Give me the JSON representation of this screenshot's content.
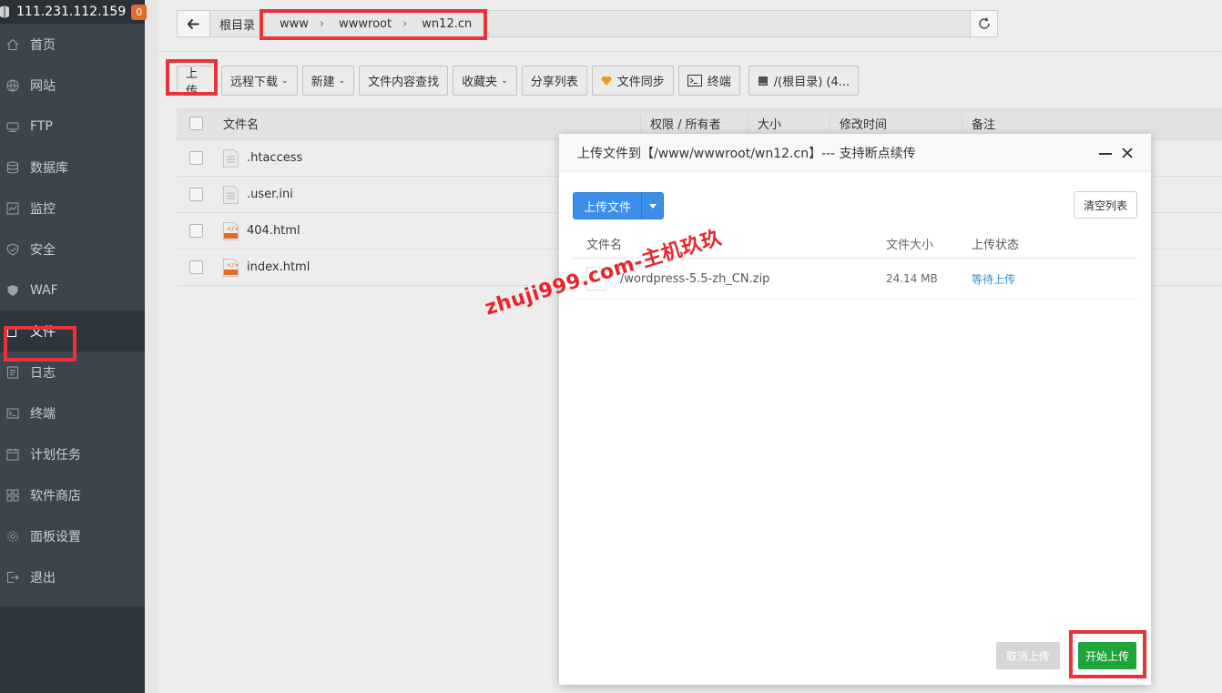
{
  "server": {
    "ip": "111.231.112.159",
    "badge_count": "0"
  },
  "sidebar": {
    "items": [
      {
        "label": "首页",
        "icon": "home-icon"
      },
      {
        "label": "网站",
        "icon": "globe-icon"
      },
      {
        "label": "FTP",
        "icon": "ftp-icon"
      },
      {
        "label": "数据库",
        "icon": "database-icon"
      },
      {
        "label": "监控",
        "icon": "monitor-icon"
      },
      {
        "label": "安全",
        "icon": "shield-icon"
      },
      {
        "label": "WAF",
        "icon": "waf-shield-icon"
      },
      {
        "label": "文件",
        "icon": "folder-icon",
        "active": true
      },
      {
        "label": "日志",
        "icon": "log-icon"
      },
      {
        "label": "终端",
        "icon": "terminal-icon"
      },
      {
        "label": "计划任务",
        "icon": "calendar-icon"
      },
      {
        "label": "软件商店",
        "icon": "apps-icon"
      },
      {
        "label": "面板设置",
        "icon": "gear-icon"
      },
      {
        "label": "退出",
        "icon": "logout-icon"
      }
    ]
  },
  "breadcrumb": {
    "root": "根目录",
    "segments": [
      "www",
      "wwwroot",
      "wn12.cn"
    ]
  },
  "toolbar": {
    "upload": "上传",
    "remote_download": "远程下载",
    "new": "新建",
    "search_content": "文件内容查找",
    "favorites": "收藏夹",
    "share_list": "分享列表",
    "file_sync": "文件同步",
    "terminal": "终端",
    "disk": "/(根目录) (4..."
  },
  "file_table": {
    "headers": {
      "name": "文件名",
      "perm": "权限 / 所有者",
      "size": "大小",
      "mtime": "修改时间",
      "note": "备注"
    },
    "rows": [
      {
        "name": ".htaccess",
        "type": "text"
      },
      {
        "name": ".user.ini",
        "type": "text"
      },
      {
        "name": "404.html",
        "type": "html"
      },
      {
        "name": "index.html",
        "type": "html"
      }
    ]
  },
  "dialog": {
    "title": "上传文件到【/www/wwwroot/wn12.cn】--- 支持断点续传",
    "upload_button": "上传文件",
    "clear_button": "清空列表",
    "headers": {
      "name": "文件名",
      "size": "文件大小",
      "status": "上传状态"
    },
    "files": [
      {
        "name": "/wordpress-5.5-zh_CN.zip",
        "size": "24.14 MB",
        "status": "等待上传"
      }
    ],
    "cancel_button": "取消上传",
    "start_button": "开始上传"
  },
  "watermark": "zhuji999.com-主机玖玖",
  "colors": {
    "sidebar": "#3c444d",
    "accent_blue": "#3c8ee8",
    "start_green": "#20a53a",
    "highlight_red": "#e8333a",
    "status_blue": "#2e8fd4"
  }
}
